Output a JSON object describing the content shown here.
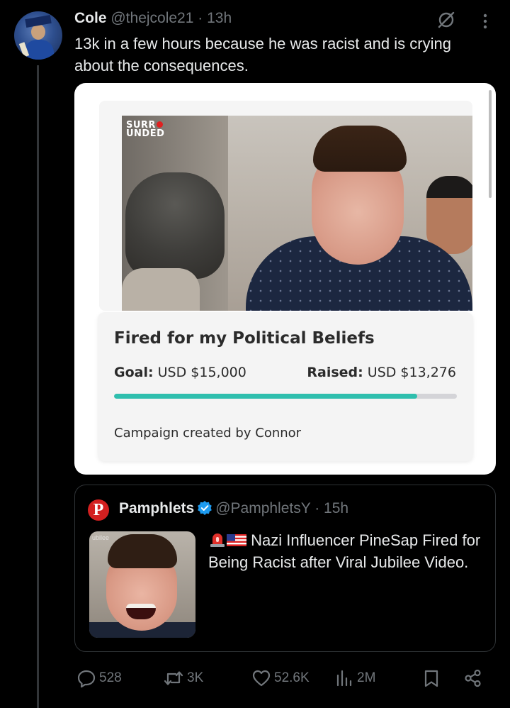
{
  "tweet": {
    "author_name": "Cole",
    "author_handle": "@thejcole21",
    "time": "· 13h",
    "text": "13k in a few hours because he was racist and is crying about the consequences."
  },
  "media": {
    "video_logo_line1": "SURR",
    "video_logo_line2": "UNDED",
    "campaign_title": "Fired for my Political Beliefs",
    "goal_label": "Goal:",
    "goal_value": "USD $15,000",
    "raised_label": "Raised:",
    "raised_value": "USD $13,276",
    "progress_fraction": 0.885,
    "creator_prefix": "Campaign created by",
    "creator_name": "Connor"
  },
  "quote": {
    "logo_letter": "P",
    "author_name": "Pamphlets",
    "author_handle": "@PamphletsY",
    "time": "· 15h",
    "text": "Nazi Influencer PineSap Fired for Being Racist after Viral Jubilee Video.",
    "thumb_watermark": "ubilee"
  },
  "actions": {
    "replies": "528",
    "reposts": "3K",
    "likes": "52.6K",
    "views": "2M"
  },
  "colors": {
    "background": "#000000",
    "text_primary": "#e7e9ea",
    "text_secondary": "#71767b",
    "progress": "#2fbfae",
    "verified": "#1d9bf0",
    "pamphlets_red": "#d32020"
  },
  "icons": [
    "grok-icon",
    "more-icon",
    "verified-icon",
    "reply-icon",
    "repost-icon",
    "like-icon",
    "views-icon",
    "bookmark-icon",
    "share-icon"
  ]
}
